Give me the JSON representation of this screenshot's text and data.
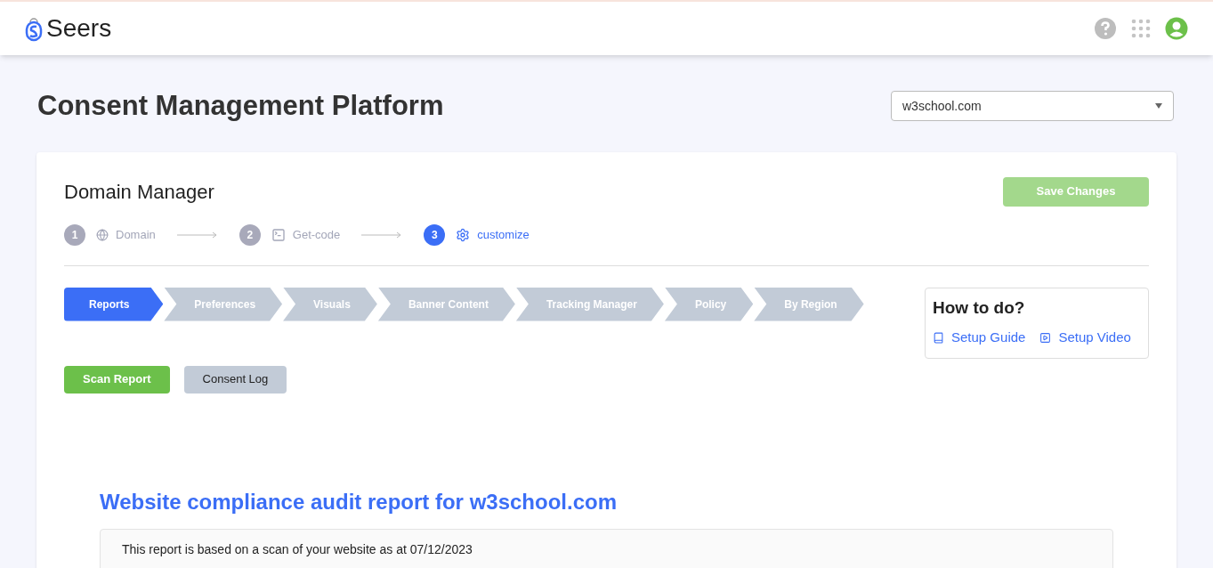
{
  "header": {
    "logo_text": "Seers"
  },
  "page_title": "Consent Management Platform",
  "domain_select": {
    "value": "w3school.com"
  },
  "card": {
    "title": "Domain Manager",
    "save_button": "Save Changes",
    "steps": [
      {
        "number": "1",
        "label": "Domain",
        "selected": false
      },
      {
        "number": "2",
        "label": "Get-code",
        "selected": false
      },
      {
        "number": "3",
        "label": "customize",
        "selected": true
      }
    ],
    "tabs": [
      {
        "label": "Reports",
        "selected": true
      },
      {
        "label": "Preferences",
        "selected": false
      },
      {
        "label": "Visuals",
        "selected": false
      },
      {
        "label": "Banner Content",
        "selected": false
      },
      {
        "label": "Tracking Manager",
        "selected": false
      },
      {
        "label": "Policy",
        "selected": false
      },
      {
        "label": "By Region",
        "selected": false
      }
    ],
    "sub_buttons": [
      {
        "label": "Scan Report",
        "selected": true
      },
      {
        "label": "Consent Log",
        "selected": false
      }
    ],
    "how_to": {
      "title": "How to do?",
      "links": [
        {
          "label": "Setup Guide"
        },
        {
          "label": "Setup Video"
        }
      ]
    },
    "report": {
      "title": "Website compliance audit report for w3school.com",
      "text": "This report is based on a scan of your website as at 07/12/2023"
    }
  }
}
